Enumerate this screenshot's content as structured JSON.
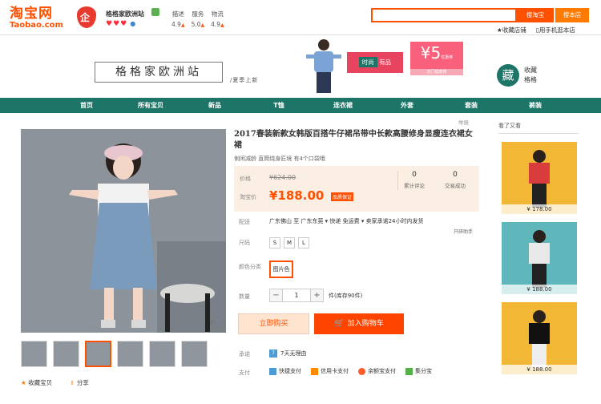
{
  "header": {
    "logo_cn": "淘宝网",
    "logo_en": "Taobao.com",
    "shop_name": "格格家欧洲站",
    "hearts": "♥♥♥",
    "ratings": [
      {
        "label": "描述",
        "value": "4.9"
      },
      {
        "label": "服务",
        "value": "5.0"
      },
      {
        "label": "物流",
        "value": "4.9"
      }
    ],
    "search_button": "搜淘宝",
    "shop_search_button": "搜本店",
    "links": [
      "收藏店铺",
      "用手机逛本店"
    ]
  },
  "banner": {
    "shop_title": "格格家欧洲站",
    "tagline": "/夏季上新",
    "promo_left": "时尚",
    "promo_right": "有品",
    "coupon_amount": "¥5",
    "coupon_unit": "优惠券",
    "coupon_foot": "无门槛使用",
    "collect_char": "藏",
    "collect_line1": "收藏",
    "collect_line2": "格格"
  },
  "nav": [
    "首页",
    "所有宝贝",
    "新品",
    "T恤",
    "连衣裙",
    "外套",
    "套装",
    "裤装"
  ],
  "product": {
    "report": "举报",
    "title": "2017春装新款女韩版百搭牛仔裙吊带中长款高腰修身显瘦连衣裙女裙",
    "subtitle": "俐闲减龄 直筒绕身匠境 有4个口袋哦",
    "price_label": "价格",
    "old_price": "¥624.00",
    "taobao_price_label": "淘宝价",
    "price": "¥188.00",
    "price_tag": "品质保证",
    "stats": [
      {
        "count": "0",
        "label": "累计评论"
      },
      {
        "count": "0",
        "label": "交易成功"
      }
    ],
    "shipping_label": "配送",
    "shipping": "广东佛山 至  广东东莞 ▾   快递 免运费 ▾   卖家承诺24小时内发货",
    "delivery_note": "只研助手",
    "size_label": "尺码",
    "sizes": [
      "S",
      "M",
      "L"
    ],
    "color_label": "颜色分类",
    "color_option": "图片色",
    "qty_label": "数量",
    "qty_minus": "−",
    "qty_value": "1",
    "qty_plus": "+",
    "stock": "件(库存90件)",
    "buy_now": "立即购买",
    "add_cart": "加入购物车",
    "promise_label": "承诺",
    "promise": "7天无理由",
    "pay_label": "支付",
    "pay_methods": [
      "快捷支付",
      "信用卡支付",
      "余额宝支付",
      "集分宝"
    ],
    "collect": "收藏宝贝",
    "share": "分享"
  },
  "sidebar": {
    "title": "看了又看",
    "items": [
      {
        "price": "¥ 178.00"
      },
      {
        "price": "¥ 188.00"
      },
      {
        "price": "¥ 188.00"
      }
    ]
  },
  "colors": {
    "brand_orange": "#ff5000",
    "nav_green": "#1c7567",
    "price_bg": "#fbeee2"
  }
}
